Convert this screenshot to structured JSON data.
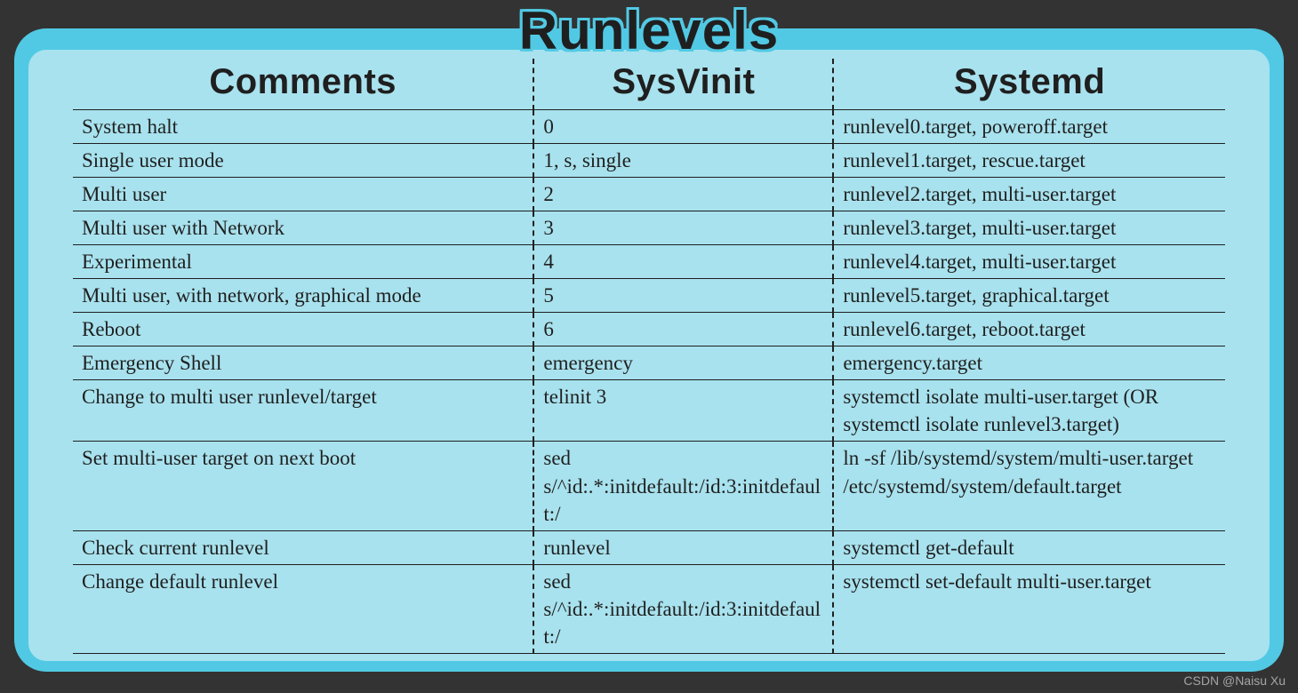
{
  "title": "Runlevels",
  "watermark": "CSDN @Naisu Xu",
  "table": {
    "headers": [
      "Comments",
      "SysVinit",
      "Systemd"
    ],
    "rows": [
      {
        "comments": "System halt",
        "sysvinit": "0",
        "systemd": "runlevel0.target, poweroff.target"
      },
      {
        "comments": "Single user mode",
        "sysvinit": "1, s, single",
        "systemd": "runlevel1.target, rescue.target"
      },
      {
        "comments": "Multi user",
        "sysvinit": "2",
        "systemd": "runlevel2.target, multi-user.target"
      },
      {
        "comments": "Multi user with Network",
        "sysvinit": "3",
        "systemd": "runlevel3.target, multi-user.target"
      },
      {
        "comments": "Experimental",
        "sysvinit": "4",
        "systemd": "runlevel4.target, multi-user.target"
      },
      {
        "comments": "Multi user, with network, graphical mode",
        "sysvinit": "5",
        "systemd": "runlevel5.target, graphical.target"
      },
      {
        "comments": "Reboot",
        "sysvinit": "6",
        "systemd": "runlevel6.target, reboot.target"
      },
      {
        "comments": "Emergency Shell",
        "sysvinit": "emergency",
        "systemd": "emergency.target"
      },
      {
        "comments": "Change to multi user runlevel/target",
        "sysvinit": "telinit 3",
        "systemd": "systemctl isolate multi-user.target (OR systemctl isolate runlevel3.target)"
      },
      {
        "comments": "Set multi-user target on next boot",
        "sysvinit": "sed s/^id:.*:initdefault:/id:3:initdefault:/",
        "systemd": "ln -sf /lib/systemd/system/multi-user.target /etc/systemd/system/default.target"
      },
      {
        "comments": "Check current runlevel",
        "sysvinit": "runlevel",
        "systemd": "systemctl get-default"
      },
      {
        "comments": "Change default runlevel",
        "sysvinit": "sed s/^id:.*:initdefault:/id:3:initdefault:/",
        "systemd": "systemctl set-default multi-user.target"
      }
    ]
  }
}
